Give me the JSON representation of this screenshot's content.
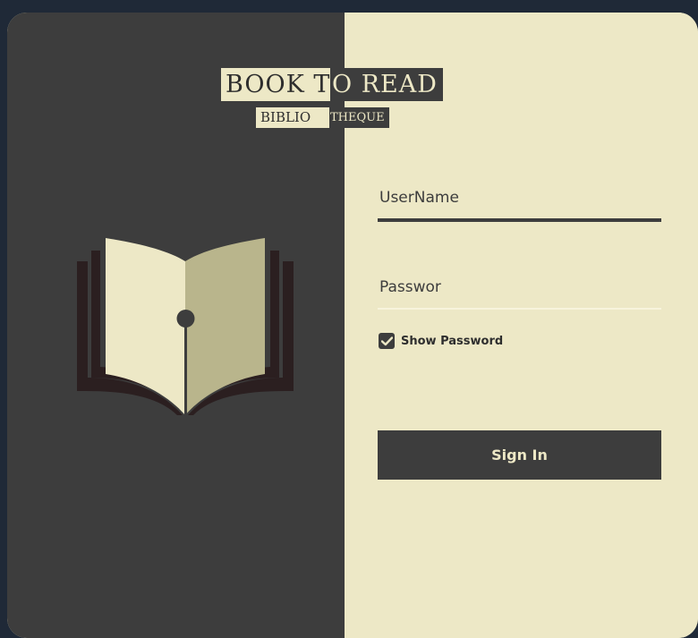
{
  "logo": {
    "line1_dark": "BOOK T",
    "line1_light": "O READ",
    "line2_dark": "BIBLIO",
    "line2_light": "THEQUE"
  },
  "icons": {
    "book": "open-book-pen-icon",
    "check": "checkmark-icon"
  },
  "form": {
    "username_placeholder": "UserName",
    "password_placeholder": "Passwor",
    "show_password_label": "Show Password",
    "show_password_checked": true,
    "signin_label": "Sign In"
  },
  "colors": {
    "dark": "#3d3d3d",
    "light": "#ede8c6",
    "book_page_left": "#ede8c6",
    "book_page_right": "#b9b58c",
    "book_edges": "#2b1f20"
  }
}
